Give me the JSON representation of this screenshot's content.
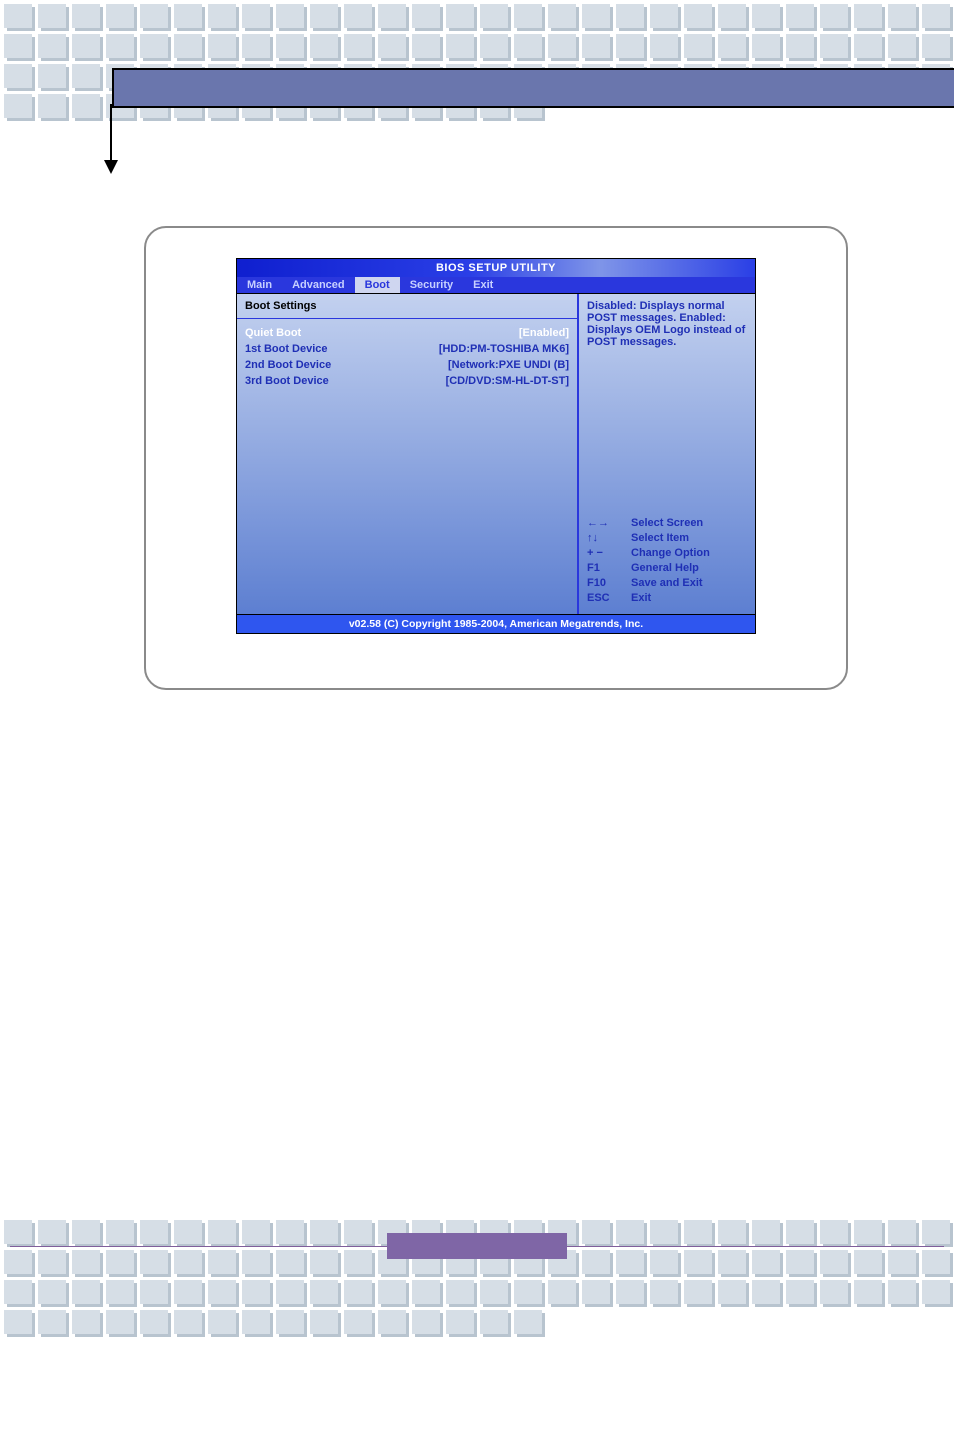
{
  "bios": {
    "title": "BIOS SETUP UTILITY",
    "menu": [
      "Main",
      "Advanced",
      "Boot",
      "Security",
      "Exit"
    ],
    "activeMenuIndex": 2,
    "panelHeading": "Boot Settings",
    "rows": [
      {
        "label": "Quiet Boot",
        "value": "[Enabled]",
        "selected": true
      },
      {
        "label": "1st Boot Device",
        "value": "[HDD:PM-TOSHIBA MK6]"
      },
      {
        "label": "2nd Boot Device",
        "value": "[Network:PXE UNDI (B]"
      },
      {
        "label": "3rd Boot Device",
        "value": "[CD/DVD:SM-HL-DT-ST]"
      }
    ],
    "helpText": "Disabled:  Displays normal POST messages. Enabled:  Displays OEM Logo instead of POST messages.",
    "legend": [
      {
        "key": "←→",
        "action": "Select Screen"
      },
      {
        "key": "↑↓",
        "action": "Select Item"
      },
      {
        "key": "+ −",
        "action": "Change Option"
      },
      {
        "key": "F1",
        "action": "General Help"
      },
      {
        "key": "F10",
        "action": "Save and Exit"
      },
      {
        "key": "ESC",
        "action": "Exit"
      }
    ],
    "footer": "v02.58 (C) Copyright  1985-2004, American Megatrends, Inc."
  }
}
